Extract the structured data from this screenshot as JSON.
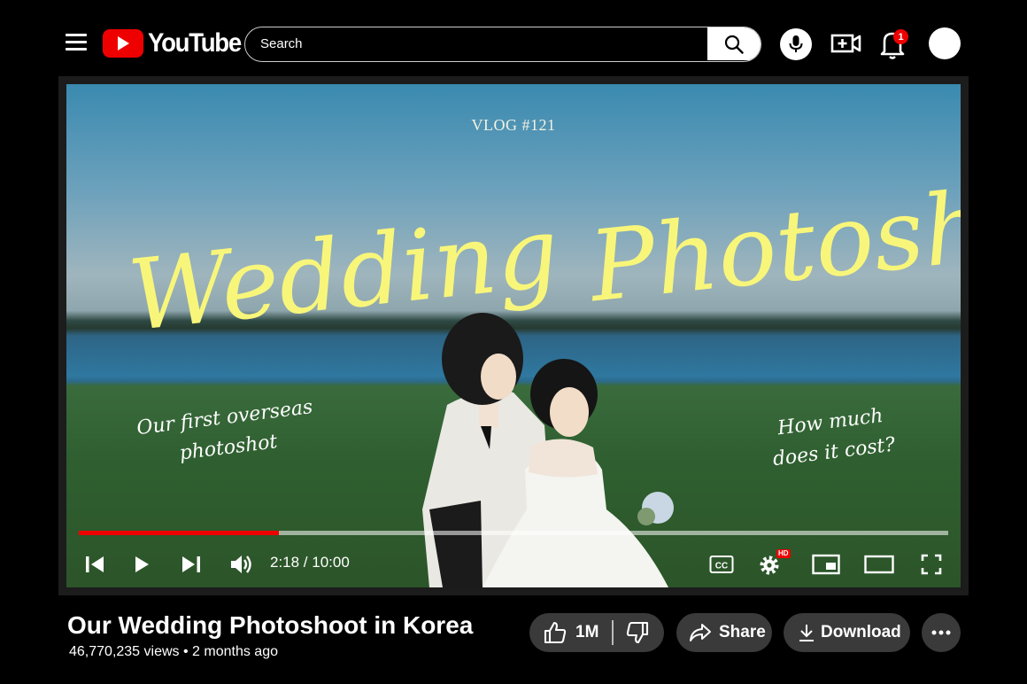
{
  "header": {
    "logo_text": "YouTube",
    "search_placeholder": "Search",
    "notification_count": "1"
  },
  "video": {
    "overlay_label": "VLOG #121",
    "overlay_title_left": "Wedding",
    "overlay_title_right": "Photoshoot",
    "overlay_note_left": "Our first overseas photoshot",
    "overlay_note_right": "How much does it cost?",
    "progress": 0.23,
    "time": "2:18 / 10:00",
    "hd_badge": "HD"
  },
  "info": {
    "title": "Our Wedding Photoshoot in Korea",
    "views": "46,770,235 views",
    "uploaded": "2 months ago",
    "likes": "1M",
    "share_label": "Share",
    "download_label": "Download"
  },
  "colors": {
    "accent": "#ee0000",
    "script_yellow": "#f8f67a",
    "button_bg": "#3a3a3a"
  }
}
